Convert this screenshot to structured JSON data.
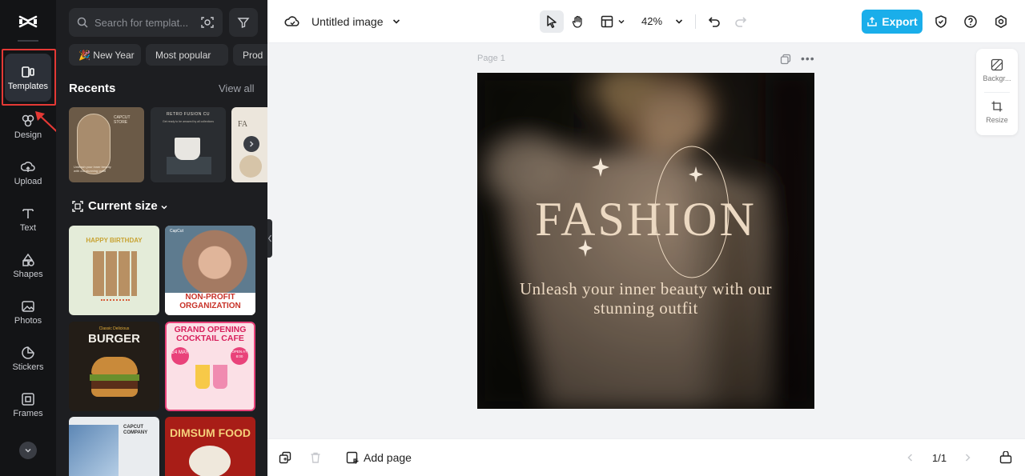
{
  "rail": {
    "items": [
      {
        "label": "Templates",
        "icon": "templates-icon"
      },
      {
        "label": "Design",
        "icon": "design-icon"
      },
      {
        "label": "Upload",
        "icon": "upload-icon"
      },
      {
        "label": "Text",
        "icon": "text-icon"
      },
      {
        "label": "Shapes",
        "icon": "shapes-icon"
      },
      {
        "label": "Photos",
        "icon": "photos-icon"
      },
      {
        "label": "Stickers",
        "icon": "stickers-icon"
      },
      {
        "label": "Frames",
        "icon": "frames-icon"
      }
    ]
  },
  "panel": {
    "search_placeholder": "Search for templat...",
    "chips": [
      "🎉 New Year",
      "Most popular",
      "Prod"
    ],
    "recents_title": "Recents",
    "view_all": "View all",
    "current_size": "Current size",
    "recents": [
      {
        "title": "CAPCUT STORE",
        "text": "Unleash your inner beauty with our stunning outfit"
      },
      {
        "title": "RETRO FUSION CU",
        "text": "Get ready to be amazed by all collections"
      },
      {
        "title": "FA",
        "text": ""
      }
    ],
    "templates": [
      {
        "title": "HAPPY BIRTHDAY"
      },
      {
        "title": "NON-PROFIT ORGANIZATION",
        "brand": "CapCut"
      },
      {
        "title": "BURGER",
        "subtitle": "Classic Delicious"
      },
      {
        "title": "GRAND OPENING COCKTAIL CAFE",
        "badge_date": "24 MAY",
        "badge_open": "OPEN AT 8:00"
      },
      {
        "title": "CAPCUT COMPANY"
      },
      {
        "title": "DIMSUM FOOD"
      }
    ]
  },
  "topbar": {
    "doc_title": "Untitled image",
    "zoom": "42%",
    "export_label": "Export"
  },
  "canvas": {
    "page_label": "Page 1",
    "headline": "FASHION",
    "tagline": "Unleash your inner beauty with our stunning outfit"
  },
  "side_tools": {
    "background_label": "Backgr...",
    "resize_label": "Resize"
  },
  "bottombar": {
    "add_page": "Add page",
    "pager": "1/1"
  },
  "colors": {
    "accent": "#1aaeea",
    "rail_bg": "#131416",
    "panel_bg": "#1d1e21",
    "highlight": "#e53935",
    "headline_text": "#ecd9c2"
  }
}
